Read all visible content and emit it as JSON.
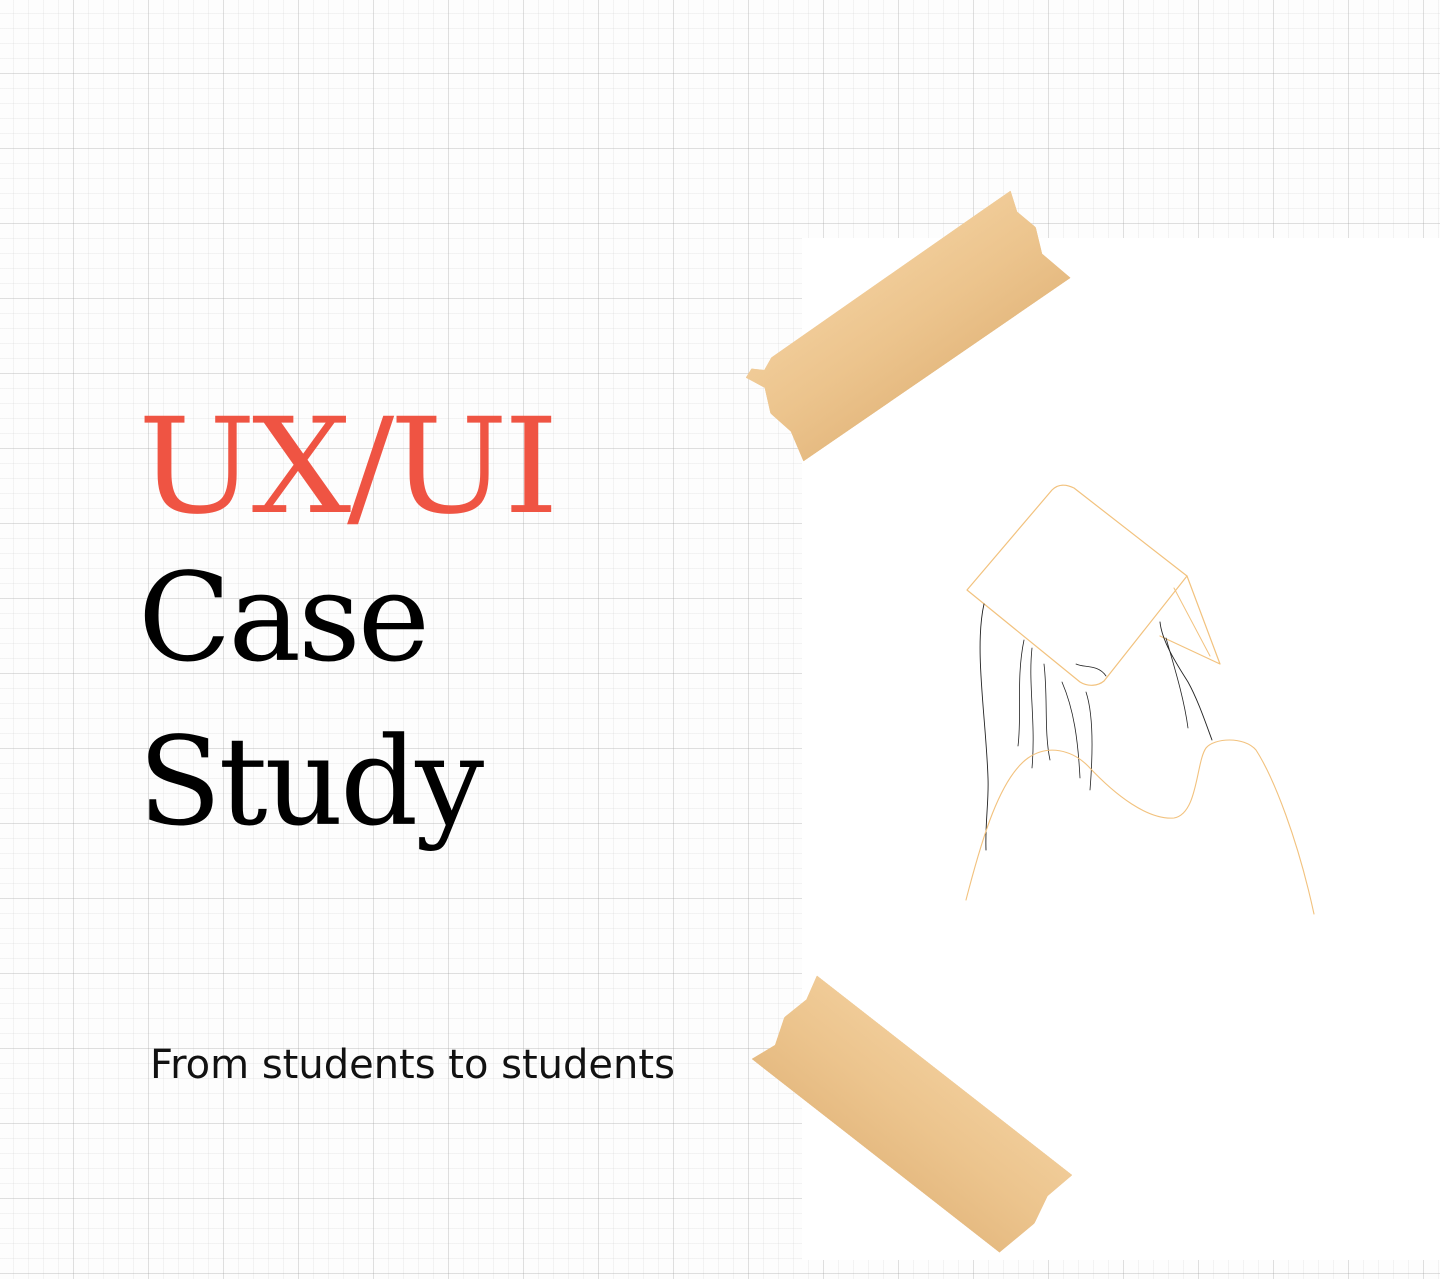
{
  "cover": {
    "title_accent": "UX/UI",
    "title_line_2": "Case",
    "title_line_3": "Study",
    "subtitle": "From students to students"
  },
  "colors": {
    "accent": "#ef5443",
    "title": "#000000",
    "tape": "#edc590",
    "line_art_outline": "#f2c27e",
    "line_art_hair": "#222222"
  },
  "illustration": {
    "subject": "person-reading-book-line-art"
  }
}
